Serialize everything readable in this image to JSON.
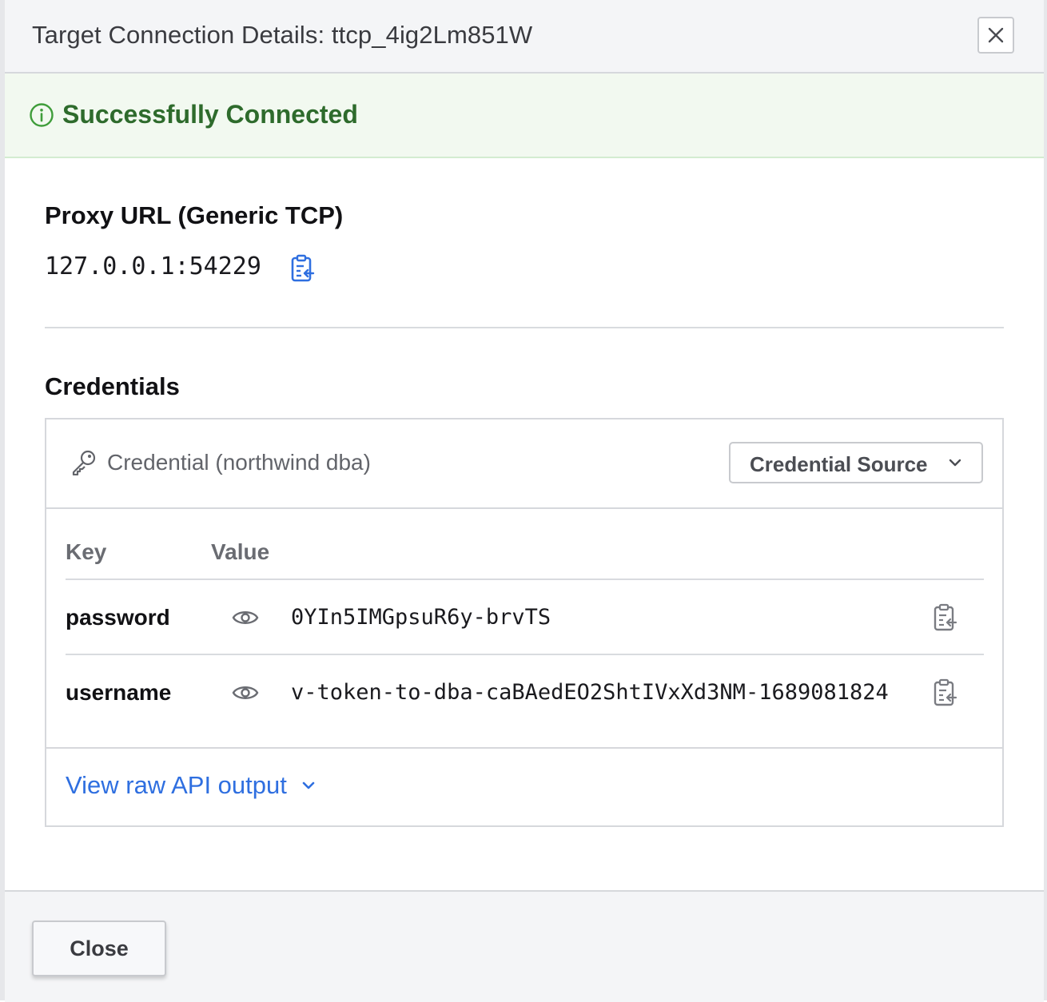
{
  "modal": {
    "title": "Target Connection Details: ttcp_4ig2Lm851W",
    "close_icon": "close-icon"
  },
  "banner": {
    "text": "Successfully Connected",
    "icon": "info-circle-icon",
    "color": "#2e6b2c"
  },
  "proxy": {
    "heading": "Proxy URL (Generic TCP)",
    "url": "127.0.0.1:54229",
    "copy_icon": "clipboard-copy-icon"
  },
  "credentials": {
    "heading": "Credentials",
    "credential_label": "Credential (northwind dba)",
    "source_button": "Credential Source",
    "columns": {
      "key": "Key",
      "value": "Value"
    },
    "rows": [
      {
        "key": "password",
        "value": "0YIn5IMGpsuR6y-brvTS"
      },
      {
        "key": "username",
        "value": "v-token-to-dba-caBAedEO2ShtIVxXd3NM-1689081824"
      }
    ],
    "raw_link": "View raw API output"
  },
  "footer": {
    "close_button": "Close"
  },
  "colors": {
    "accent": "#2f6fe0",
    "success": "#2e6b2c",
    "header_bg": "#f4f5f7"
  }
}
